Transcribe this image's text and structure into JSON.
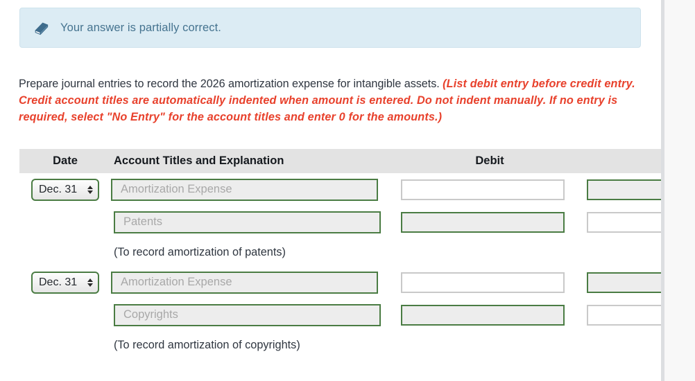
{
  "alert": {
    "icon": "eraser-icon",
    "message": "Your answer is partially correct.",
    "background_color": "#dcecf4",
    "text_color": "#45738f"
  },
  "instruction": {
    "lead": "Prepare journal entries to record the 2026 amortization expense for intangible assets. ",
    "emphasis": "(List debit entry before credit entry. Credit account titles are automatically indented when amount is entered. Do not indent manually. If no entry is required, select \"No Entry\" for the account titles and enter 0 for the amounts.)",
    "emphasis_color": "#e8412c"
  },
  "table": {
    "headers": {
      "date": "Date",
      "account": "Account Titles and Explanation",
      "debit": "Debit",
      "credit": ""
    },
    "header_background": "#e3e3e3",
    "accent_border": "#4a7c43",
    "groups": [
      {
        "date": "Dec. 31",
        "rows": [
          {
            "account_placeholder": "Amortization Expense",
            "debit_value": "",
            "debit_state": "plain",
            "credit_value": "",
            "credit_state": "active",
            "indented": false
          },
          {
            "account_placeholder": "Patents",
            "debit_value": "",
            "debit_state": "active",
            "credit_value": "",
            "credit_state": "plain",
            "indented": true
          }
        ],
        "explanation": "(To record amortization of patents)"
      },
      {
        "date": "Dec. 31",
        "rows": [
          {
            "account_placeholder": "Amortization Expense",
            "debit_value": "",
            "debit_state": "plain",
            "credit_value": "",
            "credit_state": "active",
            "indented": false
          },
          {
            "account_placeholder": "Copyrights",
            "debit_value": "",
            "debit_state": "active",
            "credit_value": "",
            "credit_state": "plain",
            "indented": true
          }
        ],
        "explanation": "(To record amortization of copyrights)"
      }
    ]
  }
}
